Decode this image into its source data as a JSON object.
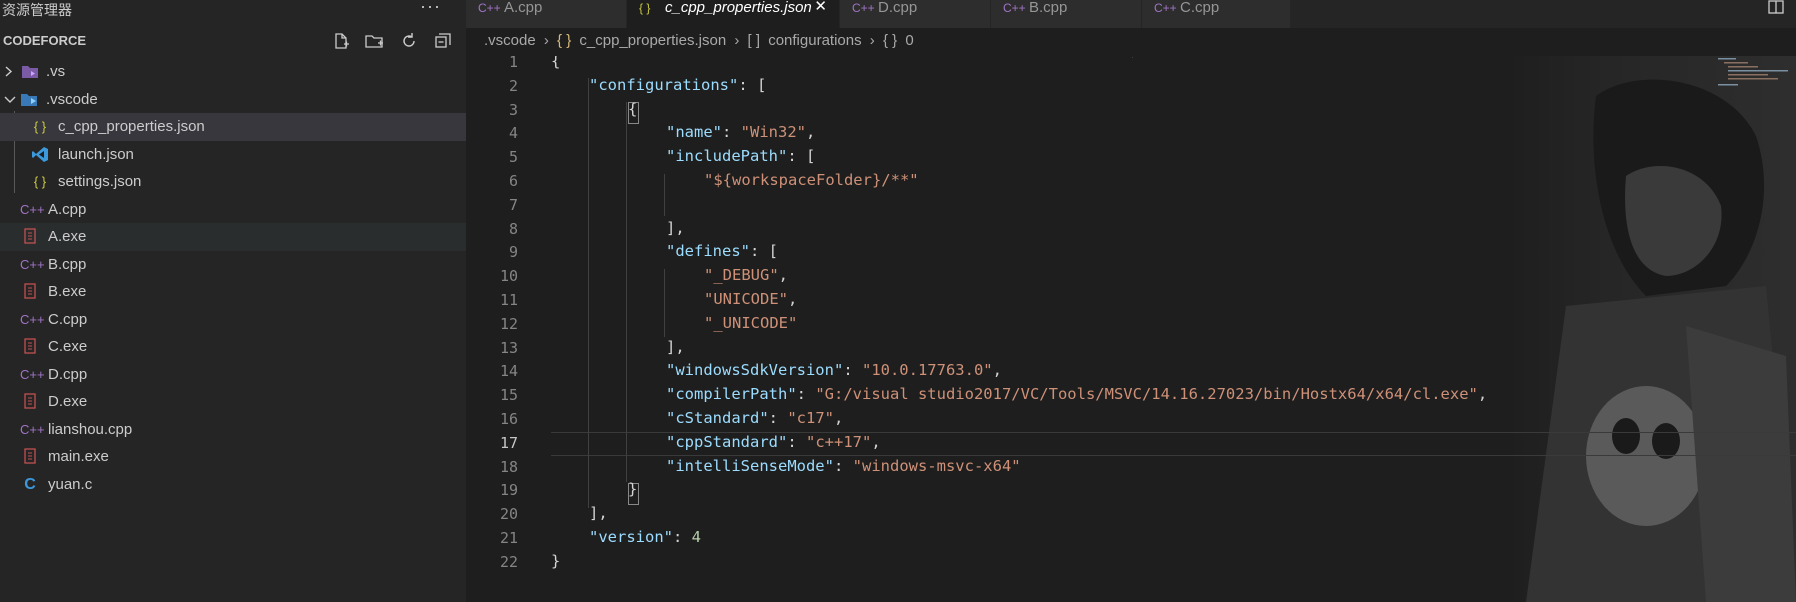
{
  "sidebar": {
    "title": "资源管理器",
    "more": "···",
    "project": "CODEFORCE",
    "items": [
      {
        "label": ".vs",
        "type": "folder-collapsed",
        "icon": "vs-folder-icon"
      },
      {
        "label": ".vscode",
        "type": "folder-expanded",
        "icon": "vscode-folder-icon"
      },
      {
        "label": "c_cpp_properties.json",
        "type": "json",
        "icon": "json-icon"
      },
      {
        "label": "launch.json",
        "type": "vscode",
        "icon": "vscode-logo-icon"
      },
      {
        "label": "settings.json",
        "type": "json",
        "icon": "json-icon"
      },
      {
        "label": "A.cpp",
        "type": "cpp",
        "icon": "cpp-icon"
      },
      {
        "label": "A.exe",
        "type": "exe",
        "icon": "exe-icon"
      },
      {
        "label": "B.cpp",
        "type": "cpp",
        "icon": "cpp-icon"
      },
      {
        "label": "B.exe",
        "type": "exe",
        "icon": "exe-icon"
      },
      {
        "label": "C.cpp",
        "type": "cpp",
        "icon": "cpp-icon"
      },
      {
        "label": "C.exe",
        "type": "exe",
        "icon": "exe-icon"
      },
      {
        "label": "D.cpp",
        "type": "cpp",
        "icon": "cpp-icon"
      },
      {
        "label": "D.exe",
        "type": "exe",
        "icon": "exe-icon"
      },
      {
        "label": "lianshou.cpp",
        "type": "cpp",
        "icon": "cpp-icon"
      },
      {
        "label": "main.exe",
        "type": "exe",
        "icon": "exe-icon"
      },
      {
        "label": "yuan.c",
        "type": "c",
        "icon": "c-icon"
      }
    ]
  },
  "tabs": [
    {
      "label": "A.cpp",
      "icon": "cpp-icon",
      "active": false
    },
    {
      "label": "c_cpp_properties.json",
      "icon": "json-icon",
      "active": true,
      "close": "✕"
    },
    {
      "label": "D.cpp",
      "icon": "cpp-icon",
      "active": false
    },
    {
      "label": "B.cpp",
      "icon": "cpp-icon",
      "active": false
    },
    {
      "label": "C.cpp",
      "icon": "cpp-icon",
      "active": false
    }
  ],
  "breadcrumb": {
    "folder": ".vscode",
    "file_icon": "{ }",
    "file": "c_cpp_properties.json",
    "array_icon": "[ ]",
    "key": "configurations",
    "obj_icon": "{ }",
    "index": "0"
  },
  "editor": {
    "current_line": 17,
    "lines": [
      "1",
      "2",
      "3",
      "4",
      "5",
      "6",
      "7",
      "8",
      "9",
      "10",
      "11",
      "12",
      "13",
      "14",
      "15",
      "16",
      "17",
      "18",
      "19",
      "20",
      "21",
      "22"
    ],
    "tokens": {
      "configurations": "\"configurations\"",
      "name": "\"name\"",
      "name_val": "\"Win32\"",
      "includePath": "\"includePath\"",
      "includePath_val": "\"${workspaceFolder}/**\"",
      "defines": "\"defines\"",
      "def1": "\"_DEBUG\"",
      "def2": "\"UNICODE\"",
      "def3": "\"_UNICODE\"",
      "sdk": "\"windowsSdkVersion\"",
      "sdk_val": "\"10.0.17763.0\"",
      "compilerPath": "\"compilerPath\"",
      "compilerPath_val": "\"G:/visual studio2017/VC/Tools/MSVC/14.16.27023/bin/Hostx64/x64/cl.exe\"",
      "cStandard": "\"cStandard\"",
      "cStandard_val": "\"c17\"",
      "cppStandard": "\"cppStandard\"",
      "cppStandard_val": "\"c++17\"",
      "intelliSenseMode": "\"intelliSenseMode\"",
      "intelliSenseMode_val": "\"windows-msvc-x64\"",
      "version": "\"version\"",
      "version_val": "4"
    }
  },
  "colors": {
    "key": "#9cdcfe",
    "string": "#ce9178",
    "number": "#b5cea8",
    "cpp_icon": "#a074c4",
    "exe_icon": "#c05050",
    "json_icon": "#cbcb41",
    "vscode_icon": "#3c99dc"
  }
}
